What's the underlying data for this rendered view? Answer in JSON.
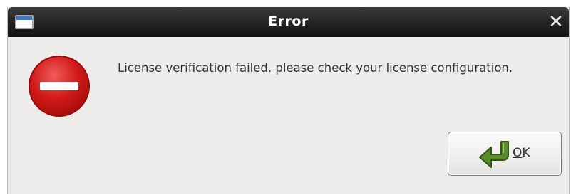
{
  "dialog": {
    "title": "Error",
    "message": "License verification failed. please check your license configuration.",
    "close_glyph": "✕",
    "icons": {
      "window": "window-icon",
      "close": "close-icon",
      "status": "error-icon",
      "ok": "arrow-return-icon"
    }
  },
  "buttons": {
    "ok": {
      "mnemonic": "O",
      "rest": "K"
    }
  },
  "colors": {
    "titlebar": "#1e1e1e",
    "dialog_background": "#edeceb",
    "error_red": "#d21a1a",
    "ok_arrow_green": "#5a8a2c",
    "text": "#2e3436"
  }
}
